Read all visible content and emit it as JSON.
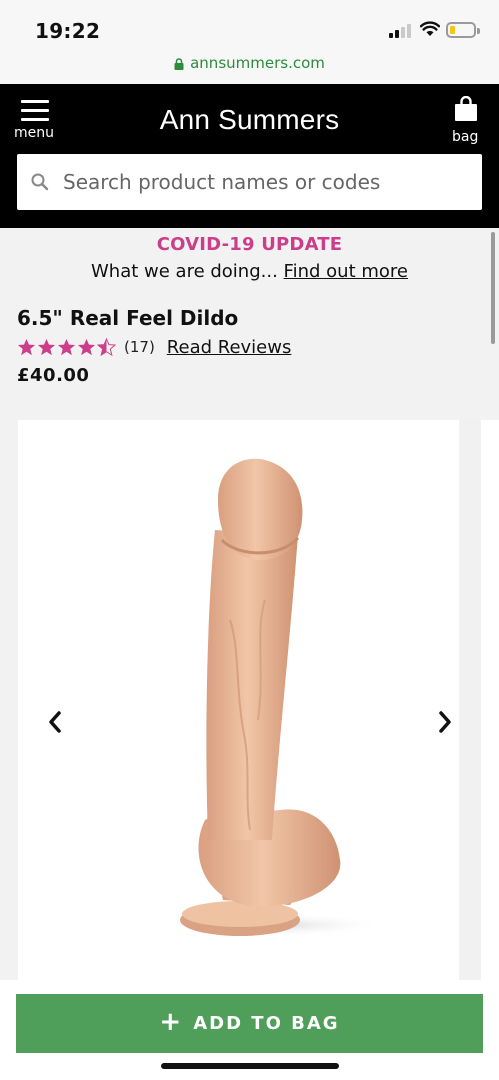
{
  "status_bar": {
    "time": "19:22"
  },
  "url_bar": {
    "domain": "annsummers.com"
  },
  "header": {
    "menu_label": "menu",
    "brand": "Ann Summers",
    "bag_label": "bag",
    "search_placeholder": "Search product names or codes"
  },
  "banner": {
    "title": "COVID-19 UPDATE",
    "text": "What we are doing...",
    "link": "Find out more"
  },
  "product": {
    "name": "6.5\" Real Feel Dildo",
    "rating": 4.5,
    "rating_max": 5,
    "review_count": "(17)",
    "read_reviews": "Read Reviews",
    "price": "£40.00"
  },
  "gallery": {
    "prev_icon": "chevron-left-icon",
    "next_icon": "chevron-right-icon"
  },
  "cta": {
    "label": "ADD TO BAG",
    "icon": "+"
  },
  "colors": {
    "header_bg": "#000000",
    "accent_pink": "#cc3d8a",
    "cta_green": "#4f9f5b",
    "url_green": "#2c8b3c"
  }
}
